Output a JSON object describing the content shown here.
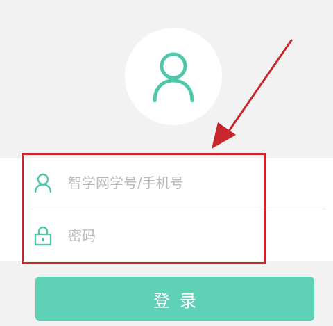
{
  "login": {
    "username_placeholder": "智学网学号/手机号",
    "password_placeholder": "密码",
    "submit_label": "登录"
  },
  "colors": {
    "accent": "#5ed1b6",
    "icon": "#4fc7ab",
    "highlight": "#c8262c",
    "placeholder": "#b9b9b9",
    "background": "#f2f2f2"
  },
  "icons": {
    "avatar": "user-avatar-icon",
    "username": "user-icon",
    "password": "lock-icon"
  }
}
